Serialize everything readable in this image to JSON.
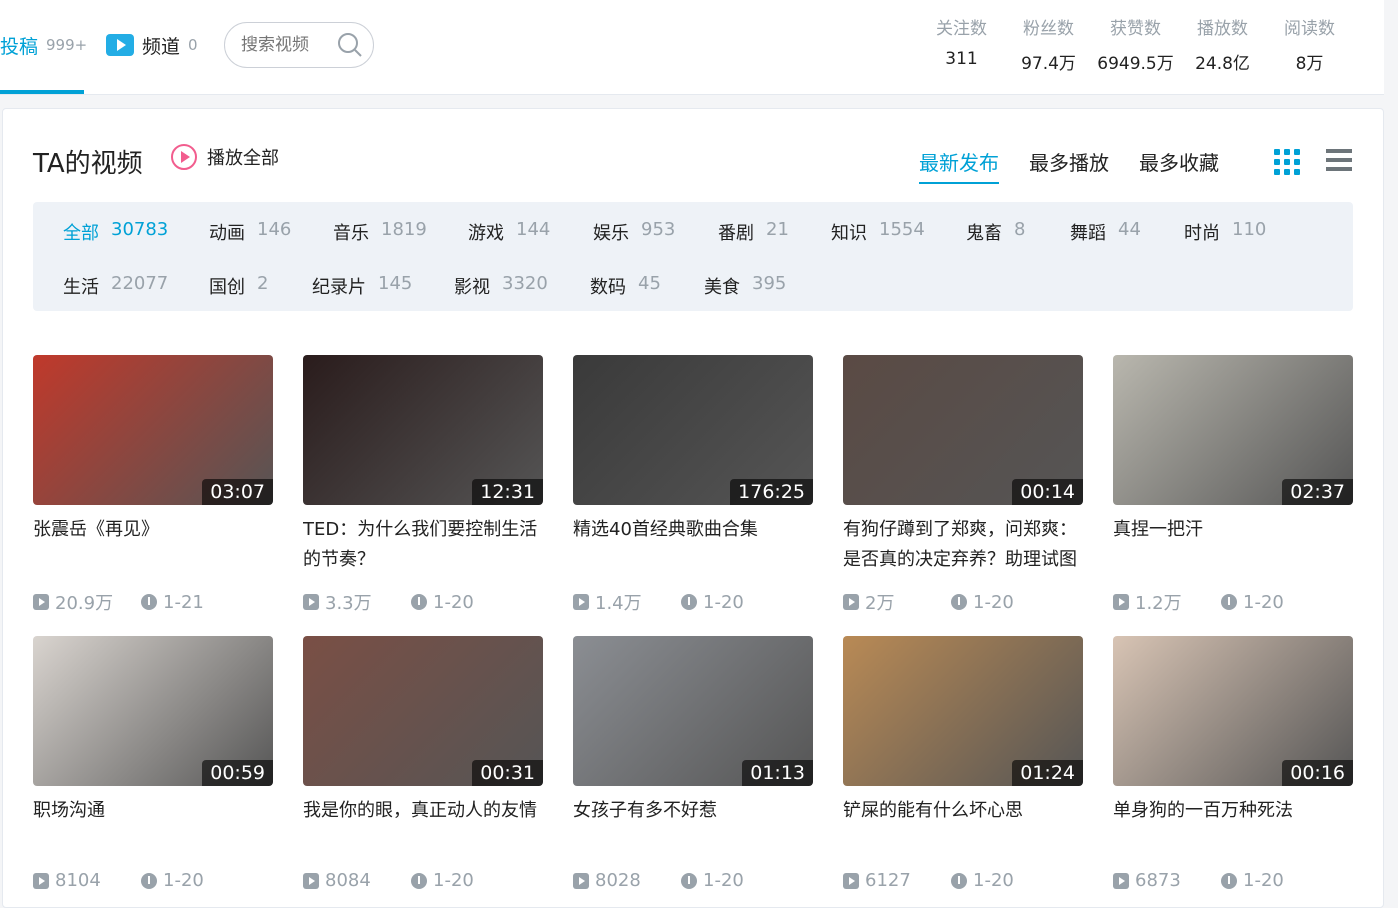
{
  "header": {
    "upload_tab": {
      "label": "投稿",
      "count": "999+"
    },
    "channel_tab": {
      "label": "频道",
      "count": "0"
    },
    "search": {
      "placeholder": "搜索视频"
    },
    "stats": [
      {
        "label": "关注数",
        "value": "311"
      },
      {
        "label": "粉丝数",
        "value": "97.4万"
      },
      {
        "label": "获赞数",
        "value": "6949.5万"
      },
      {
        "label": "播放数",
        "value": "24.8亿"
      },
      {
        "label": "阅读数",
        "value": "8万"
      }
    ]
  },
  "section": {
    "title": "TA的视频",
    "play_all": "播放全部",
    "sorts": [
      "最新发布",
      "最多播放",
      "最多收藏"
    ],
    "active_sort": "最新发布"
  },
  "categories": [
    {
      "name": "全部",
      "count": "30783",
      "active": true
    },
    {
      "name": "动画",
      "count": "146"
    },
    {
      "name": "音乐",
      "count": "1819"
    },
    {
      "name": "游戏",
      "count": "144"
    },
    {
      "name": "娱乐",
      "count": "953"
    },
    {
      "name": "番剧",
      "count": "21"
    },
    {
      "name": "知识",
      "count": "1554"
    },
    {
      "name": "鬼畜",
      "count": "8"
    },
    {
      "name": "舞蹈",
      "count": "44"
    },
    {
      "name": "时尚",
      "count": "110"
    },
    {
      "name": "生活",
      "count": "22077"
    },
    {
      "name": "国创",
      "count": "2"
    },
    {
      "name": "纪录片",
      "count": "145"
    },
    {
      "name": "影视",
      "count": "3320"
    },
    {
      "name": "数码",
      "count": "45"
    },
    {
      "name": "美食",
      "count": "395"
    }
  ],
  "videos": [
    {
      "title": "张震岳《再见》",
      "duration": "03:07",
      "plays": "20.9万",
      "date": "1-21",
      "color": "#c0392b"
    },
    {
      "title": "TED：为什么我们要控制生活的节奏？",
      "duration": "12:31",
      "plays": "3.3万",
      "date": "1-20",
      "color": "#2a1c1c"
    },
    {
      "title": "精选40首经典歌曲合集",
      "duration": "176:25",
      "plays": "1.4万",
      "date": "1-20",
      "color": "#3a3a3a"
    },
    {
      "title": "有狗仔蹲到了郑爽，问郑爽：是否真的决定弃养？助理试图",
      "duration": "00:14",
      "plays": "2万",
      "date": "1-20",
      "color": "#5a4a44"
    },
    {
      "title": "真捏一把汗",
      "duration": "02:37",
      "plays": "1.2万",
      "date": "1-20",
      "color": "#b9b7ae"
    },
    {
      "title": "职场沟通",
      "duration": "00:59",
      "plays": "8104",
      "date": "1-20",
      "color": "#d9d4cf"
    },
    {
      "title": "我是你的眼，真正动人的友情",
      "duration": "00:31",
      "plays": "8084",
      "date": "1-20",
      "color": "#7a4f45"
    },
    {
      "title": "女孩子有多不好惹",
      "duration": "01:13",
      "plays": "8028",
      "date": "1-20",
      "color": "#8b8e93"
    },
    {
      "title": "铲屎的能有什么坏心思",
      "duration": "01:24",
      "plays": "6127",
      "date": "1-20",
      "color": "#b98a55"
    },
    {
      "title": "单身狗的一百万种死法",
      "duration": "00:16",
      "plays": "6873",
      "date": "1-20",
      "color": "#d8c4b4"
    }
  ]
}
